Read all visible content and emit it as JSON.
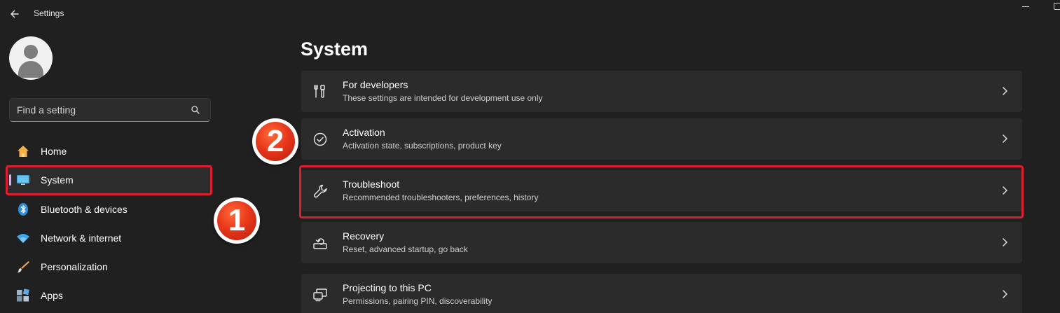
{
  "window": {
    "title": "Settings",
    "back_icon": "arrow-left-icon",
    "minimize_icon": "minimize-icon",
    "maximize_icon": "maximize-icon"
  },
  "sidebar": {
    "avatar_icon": "user-avatar-icon",
    "search": {
      "placeholder": "Find a setting",
      "value": "",
      "icon": "search-icon"
    },
    "items": [
      {
        "label": "Home",
        "icon": "home-icon",
        "active": false
      },
      {
        "label": "System",
        "icon": "system-icon",
        "active": true
      },
      {
        "label": "Bluetooth & devices",
        "icon": "bluetooth-icon",
        "active": false
      },
      {
        "label": "Network & internet",
        "icon": "wifi-icon",
        "active": false
      },
      {
        "label": "Personalization",
        "icon": "brush-icon",
        "active": false
      },
      {
        "label": "Apps",
        "icon": "apps-icon",
        "active": false
      }
    ]
  },
  "main": {
    "title": "System",
    "cards": [
      {
        "title": "For developers",
        "description": "These settings are intended for development use only",
        "icon": "developer-tools-icon"
      },
      {
        "title": "Activation",
        "description": "Activation state, subscriptions, product key",
        "icon": "check-circle-icon"
      },
      {
        "title": "Troubleshoot",
        "description": "Recommended troubleshooters, preferences, history",
        "icon": "wrench-icon"
      },
      {
        "title": "Recovery",
        "description": "Reset, advanced startup, go back",
        "icon": "recovery-icon"
      },
      {
        "title": "Projecting to this PC",
        "description": "Permissions, pairing PIN, discoverability",
        "icon": "projecting-icon"
      }
    ]
  },
  "annotations": {
    "step_1": "1",
    "step_2": "2",
    "highlight_color": "#dc1f30",
    "badge_color": "#e8381b"
  },
  "colors": {
    "background": "#202020",
    "card": "#2b2b2b",
    "accent_indicator": "#d4aaf0"
  }
}
